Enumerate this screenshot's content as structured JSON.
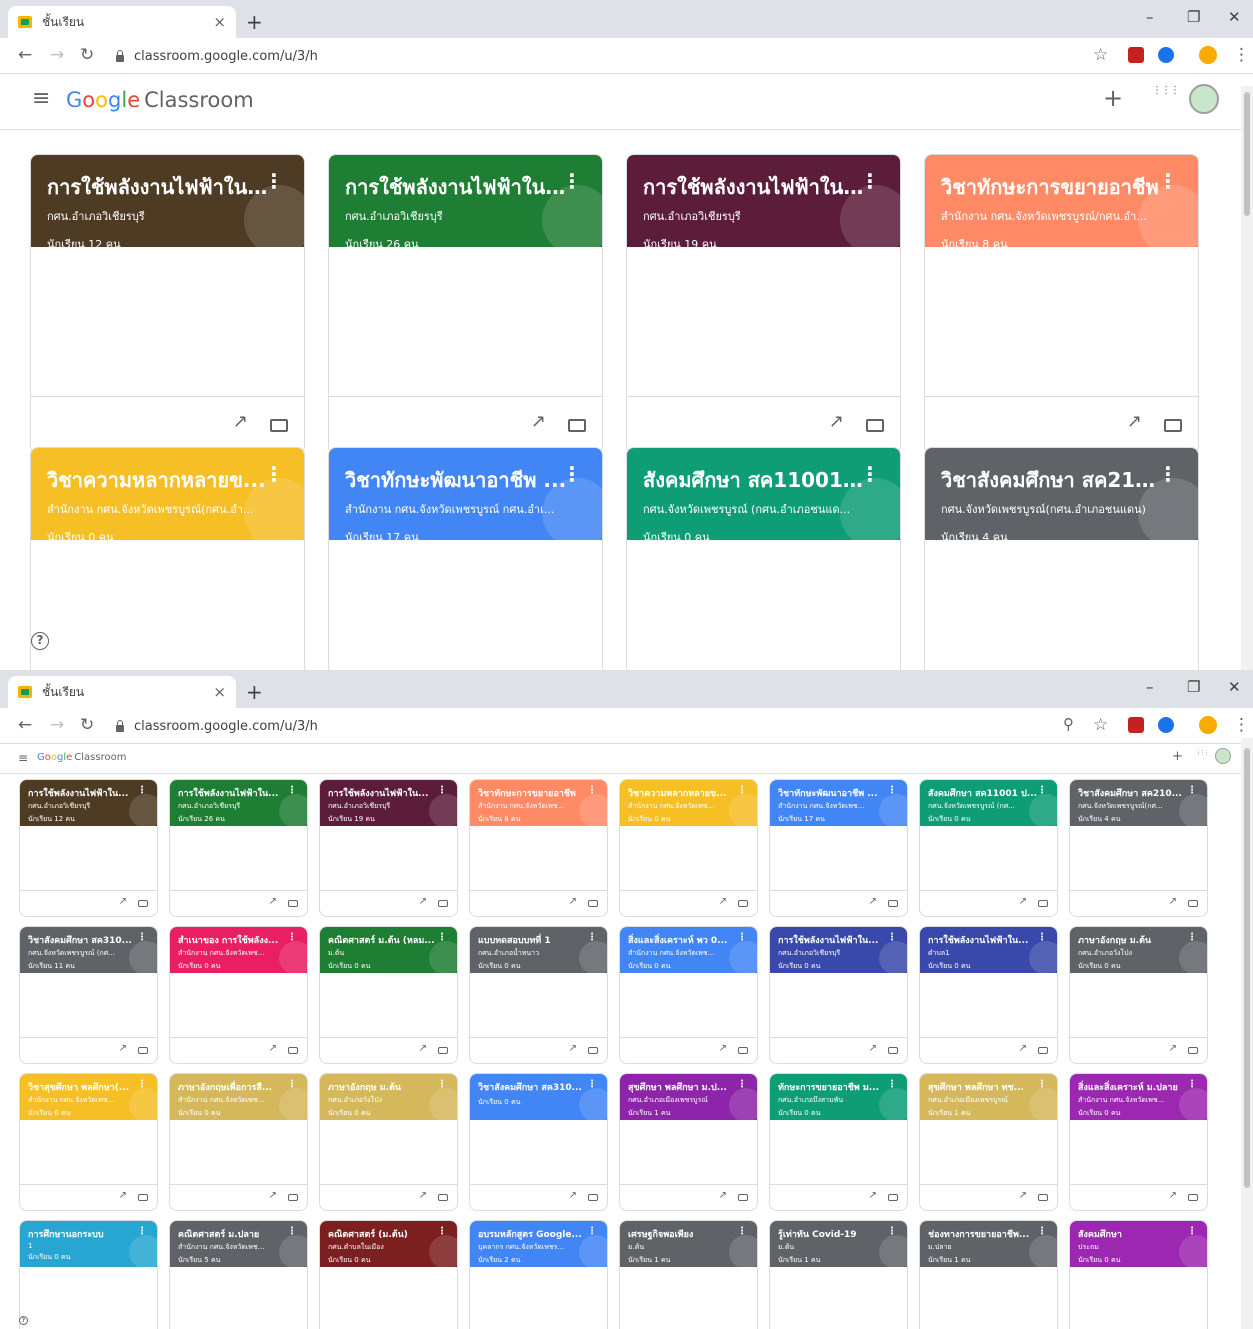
{
  "browser": {
    "tab_title": "ชั้นเรียน",
    "tab_close": "×",
    "new_tab": "+",
    "url": "classroom.google.com/u/3/h",
    "minimize": "–",
    "restore": "❐",
    "close": "✕"
  },
  "header": {
    "menu": "≡",
    "logo_parts": [
      "G",
      "o",
      "o",
      "g",
      "l",
      "e"
    ],
    "logo_product": "Classroom",
    "add": "+",
    "apps": "⋮⋮⋮"
  },
  "help_label": "?",
  "colors": {
    "brown": "#4e3b23",
    "green": "#1e7e34",
    "maroon": "#5c1d3b",
    "salmon": "#ff8a65",
    "yellow": "#f6bf26",
    "blue": "#4285f4",
    "teal": "#0f9d76",
    "gray": "#5f6368",
    "pink": "#e91e63",
    "indigo": "#3949ab",
    "khaki": "#d4b85b",
    "purple": "#8e24aa",
    "cyan": "#26a6d1",
    "darkred": "#7b1f1f",
    "violet": "#9c27b0"
  },
  "top_cards": [
    {
      "title": "การใช้พลังงานไฟฟ้าใน...",
      "section": "กศน.อำเภอวิเชียรบุรี",
      "count": "นักเรียน 12 คน",
      "color": "brown"
    },
    {
      "title": "การใช้พลังงานไฟฟ้าใน...",
      "section": "กศน.อำเภอวิเชียรบุรี",
      "count": "นักเรียน 26 คน",
      "color": "green"
    },
    {
      "title": "การใช้พลังงานไฟฟ้าใน...",
      "section": "กศน.อำเภอวิเชียรบุรี",
      "count": "นักเรียน 19 คน",
      "color": "maroon"
    },
    {
      "title": "วิชาทักษะการขยายอาชีพ",
      "section": "สำนักงาน กศน.จังหวัดเพชรบูรณ์/กศน.อำ...",
      "count": "นักเรียน 8 คน",
      "color": "salmon"
    },
    {
      "title": "วิชาความหลากหลายข...",
      "section": "สำนักงาน กศน.จังหวัดเพชรบูรณ์(กศน.อำ...",
      "count": "นักเรียน 0 คน",
      "color": "yellow"
    },
    {
      "title": "วิชาทักษะพัฒนาอาชีพ ...",
      "section": "สำนักงาน กศน.จังหวัดเพชรบูรณ์ กศน.อำเ...",
      "count": "นักเรียน 17 คน",
      "color": "blue"
    },
    {
      "title": "สังคมศึกษา สค11001 ป...",
      "section": "กศน.จังหวัดเพชรบูรณ์ (กศน.อำเภอชนแด...",
      "count": "นักเรียน 0 คน",
      "color": "teal"
    },
    {
      "title": "วิชาสังคมศึกษา สค210...",
      "section": "กศน.จังหวัดเพชรบูรณ์(กศน.อำเภอชนแดน)",
      "count": "นักเรียน 4 คน",
      "color": "gray"
    }
  ],
  "small_cards": [
    {
      "title": "การใช้พลังงานไฟฟ้าใน...",
      "section": "กศน.อำเภอวิเชียรบุรี",
      "count": "นักเรียน 12 คน",
      "color": "brown"
    },
    {
      "title": "การใช้พลังงานไฟฟ้าใน...",
      "section": "กศน.อำเภอวิเชียรบุรี",
      "count": "นักเรียน 26 คน",
      "color": "green"
    },
    {
      "title": "การใช้พลังงานไฟฟ้าใน...",
      "section": "กศน.อำเภอวิเชียรบุรี",
      "count": "นักเรียน 19 คน",
      "color": "maroon"
    },
    {
      "title": "วิชาทักษะการขยายอาชีพ",
      "section": "สำนักงาน กศน.จังหวัดเพช...",
      "count": "นักเรียน 8 คน",
      "color": "salmon"
    },
    {
      "title": "วิชาความหลากหลายข...",
      "section": "สำนักงาน กศน.จังหวัดเพช...",
      "count": "นักเรียน 0 คน",
      "color": "yellow"
    },
    {
      "title": "วิชาทักษะพัฒนาอาชีพ ...",
      "section": "สำนักงาน กศน.จังหวัดเพช...",
      "count": "นักเรียน 17 คน",
      "color": "blue"
    },
    {
      "title": "สังคมศึกษา สค11001 ป...",
      "section": "กศน.จังหวัดเพชรบูรณ์ (กศ...",
      "count": "นักเรียน 0 คน",
      "color": "teal"
    },
    {
      "title": "วิชาสังคมศึกษา สค210...",
      "section": "กศน.จังหวัดเพชรบูรณ์(กศ...",
      "count": "นักเรียน 4 คน",
      "color": "gray"
    },
    {
      "title": "วิชาสังคมศึกษา สค310...",
      "section": "กศน.จังหวัดเพชรบูรณ์ (กศ...",
      "count": "นักเรียน 11 คน",
      "color": "gray"
    },
    {
      "title": "สำเนาของ การใช้พลังง...",
      "section": "สำนักงาน กศน.จังหวัดเพช...",
      "count": "นักเรียน 0 คน",
      "color": "pink"
    },
    {
      "title": "คณิตศาสตร์ ม.ต้น (หลม...",
      "section": "ม.ต้น",
      "count": "นักเรียน 0 คน",
      "color": "green"
    },
    {
      "title": "แบบทดสอบบทที่ 1",
      "section": "กศน.อำเภอน้ำหนาว",
      "count": "นักเรียน 0 คน",
      "color": "gray"
    },
    {
      "title": "สิ่งและสิ่งเคราะห์ พว 0...",
      "section": "สำนักงาน กศน.จังหวัดเพช...",
      "count": "นักเรียน 0 คน",
      "color": "blue"
    },
    {
      "title": "การใช้พลังงานไฟฟ้าใน...",
      "section": "กศน.อำเภอวิเชียรบุรี",
      "count": "นักเรียน 0 คน",
      "color": "indigo"
    },
    {
      "title": "การใช้พลังงานไฟฟ้าใน...",
      "section": "ตำบล1",
      "count": "นักเรียน 0 คน",
      "color": "indigo"
    },
    {
      "title": "ภาษาอังกฤษ ม.ต้น",
      "section": "กศน.อำเภอวังโป่ง",
      "count": "นักเรียน 0 คน",
      "color": "gray"
    },
    {
      "title": "วิชาสุขศึกษา พลศึกษา(...",
      "section": "สำนักงาน กศน.จังหวัดเพช...",
      "count": "นักเรียน 0 คน",
      "color": "yellow"
    },
    {
      "title": "ภาษาอังกฤษเพื่อการสื...",
      "section": "สำนักงาน กศน.จังหวัดเพช...",
      "count": "นักเรียน 0 คน",
      "color": "khaki"
    },
    {
      "title": "ภาษาอังกฤษ ม.ต้น",
      "section": "กศน.อำเภอวังโป่ง",
      "count": "นักเรียน 0 คน",
      "color": "khaki"
    },
    {
      "title": "วิชาสังคมศึกษา สค310...",
      "section": "",
      "count": "นักเรียน 0 คน",
      "color": "blue"
    },
    {
      "title": "สุขศึกษา พลศึกษา ม.ป...",
      "section": "กศน.อำเภอเมืองเพชรบูรณ์",
      "count": "นักเรียน 1 คน",
      "color": "purple"
    },
    {
      "title": "ทักษะการขยายอาชีพ ม...",
      "section": "กศน.อำเภอบึงสามพัน",
      "count": "นักเรียน 0 คน",
      "color": "teal"
    },
    {
      "title": "สุขศึกษา พลศึกษา ทช...",
      "section": "กศน.อำเภอเมืองเพชรบูรณ์",
      "count": "นักเรียน 1 คน",
      "color": "khaki"
    },
    {
      "title": "สิ่งและสิ่งเคราะห์ ม.ปลาย",
      "section": "สำนักงาน กศน.จังหวัดเพช...",
      "count": "นักเรียน 0 คน",
      "color": "violet"
    },
    {
      "title": "การศึกษานอกระบบ",
      "section": "1",
      "count": "นักเรียน 0 คน",
      "color": "cyan"
    },
    {
      "title": "คณิตศาสตร์ ม.ปลาย",
      "section": "สำนักงาน กศน.จังหวัดเพช...",
      "count": "นักเรียน 5 คน",
      "color": "gray"
    },
    {
      "title": "คณิตศาสตร์ (ม.ต้น)",
      "section": "กศน.ตำบลในเมือง",
      "count": "นักเรียน 0 คน",
      "color": "darkred"
    },
    {
      "title": "อบรมหลักสูตร Google...",
      "section": "บุคลากร กศน.จังหวัดเพชร...",
      "count": "นักเรียน 2 คน",
      "color": "blue"
    },
    {
      "title": "เศรษฐกิจพอเพียง",
      "section": "ม.ต้น",
      "count": "นักเรียน 1 คน",
      "color": "gray"
    },
    {
      "title": "รู้เท่าทัน Covid-19",
      "section": "ม.ต้น",
      "count": "นักเรียน 1 คน",
      "color": "gray"
    },
    {
      "title": "ช่องทางการขยายอาชีพ...",
      "section": "ม.ปลาย",
      "count": "นักเรียน 1 คน",
      "color": "gray"
    },
    {
      "title": "สังคมศึกษา",
      "section": "ประถม",
      "count": "นักเรียน 0 คน",
      "color": "violet"
    }
  ]
}
